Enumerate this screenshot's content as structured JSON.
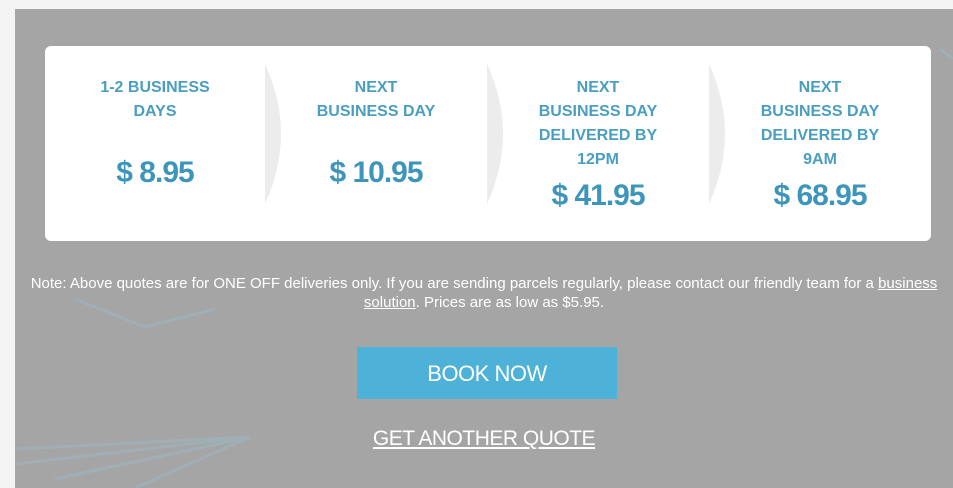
{
  "shipping_options": [
    {
      "title": "1-2 BUSINESS\nDAYS",
      "price": "$ 8.95"
    },
    {
      "title": "NEXT\nBUSINESS DAY",
      "price": "$ 10.95"
    },
    {
      "title": "NEXT\nBUSINESS DAY\nDELIVERED BY\n12PM",
      "price": "$ 41.95"
    },
    {
      "title": "NEXT\nBUSINESS DAY\nDELIVERED BY\n9AM",
      "price": "$ 68.95"
    }
  ],
  "note": {
    "before_link": "Note: Above quotes are for ONE OFF deliveries only. If you are sending parcels regularly, please contact our friendly team for a ",
    "link_text": "business solution",
    "after_link": ". Prices are as low as $5.95."
  },
  "actions": {
    "book_now": "BOOK NOW",
    "get_another_quote": "GET ANOTHER QUOTE"
  },
  "colors": {
    "accent": "#4eb1d8",
    "price_text": "#3e95bc",
    "panel_bg": "#a5a5a5"
  }
}
